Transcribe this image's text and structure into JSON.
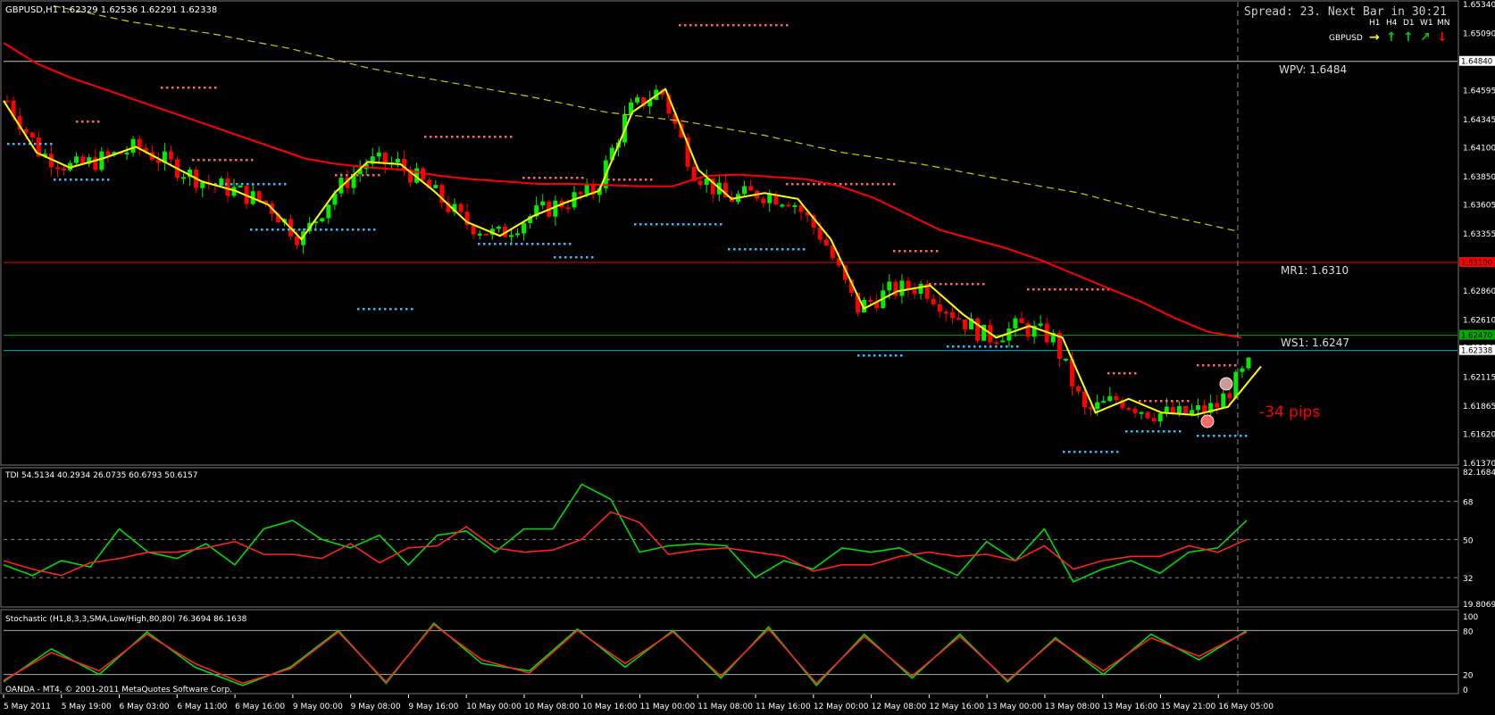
{
  "window": {
    "symbol_info": "GBPUSD,H1  1.62329 1.62536 1.62291 1.62338",
    "spread_text": "Spread: 23. Next Bar in 30:21",
    "copyright": "OANDA - MT4, © 2001-2011 MetaQuotes Software Corp."
  },
  "trend_panel": {
    "symbol": "GBPUSD",
    "timeframes": [
      "H1",
      "H4",
      "D1",
      "W1",
      "MN"
    ],
    "arrows": [
      {
        "dir": "right",
        "color": "#ffff00"
      },
      {
        "dir": "up",
        "color": "#00cc00"
      },
      {
        "dir": "up",
        "color": "#00cc00"
      },
      {
        "dir": "up-right",
        "color": "#00cc00"
      },
      {
        "dir": "down",
        "color": "#ff0000"
      }
    ]
  },
  "pivots": {
    "wpv": {
      "label": "WPV: 1.6484",
      "value": 1.6484,
      "color": "#c0c0c0"
    },
    "mr1": {
      "label": "MR1: 1.6310",
      "value": 1.631,
      "color": "#ff0000"
    },
    "ws1": {
      "label": "WS1: 1.6247",
      "value": 1.6247,
      "color": "#00aa00"
    },
    "bid": {
      "value": 1.62338,
      "color": "#00aacc"
    }
  },
  "annotation": {
    "text": "-34 pips",
    "color": "#ff0000"
  },
  "price_axis": {
    "ticks": [
      "1.65340",
      "1.65090",
      "1.64840",
      "1.64595",
      "1.64345",
      "1.64100",
      "1.63850",
      "1.63605",
      "1.63355",
      "1.63100",
      "1.62860",
      "1.62610",
      "1.62370",
      "1.62338",
      "1.62115",
      "1.61865",
      "1.61620",
      "1.61370"
    ],
    "highlighted": [
      {
        "label": "1.64840",
        "color": "#ffffff",
        "text_color": "#000000"
      },
      {
        "label": "1.63100",
        "color": "#ff0000",
        "text_color": "#000000"
      },
      {
        "label": "1.62470",
        "color": "#00aa00",
        "text_color": "#000000"
      },
      {
        "label": "1.62338",
        "color": "#ffffff",
        "text_color": "#000000"
      }
    ]
  },
  "time_axis": [
    "5 May 2011",
    "5 May 19:00",
    "6 May 03:00",
    "6 May 11:00",
    "6 May 16:00",
    "9 May 00:00",
    "9 May 08:00",
    "9 May 16:00",
    "10 May 00:00",
    "10 May 08:00",
    "10 May 16:00",
    "11 May 00:00",
    "11 May 08:00",
    "11 May 16:00",
    "12 May 00:00",
    "12 May 08:00",
    "12 May 16:00",
    "13 May 00:00",
    "13 May 08:00",
    "13 May 16:00",
    "15 May 21:00",
    "16 May 05:00"
  ],
  "tdi": {
    "label": "TDI 54.5134 40.2934 26.0735 60.6793 50.6157",
    "levels": [
      "82.1684",
      "68",
      "50",
      "32",
      "19.8069"
    ]
  },
  "stochastic": {
    "label": "Stochastic (H1,8,3,3,SMA,Low/High,80,80) 76.3694 86.1638",
    "levels": [
      "100",
      "80",
      "20",
      "0"
    ]
  },
  "chart_data": [
    {
      "type": "line",
      "title": "GBPUSD,H1",
      "ylim": [
        1.6137,
        1.6534
      ],
      "series": [
        {
          "name": "",
          "color": "#ff0000",
          "values": [
            1.65,
            1.6482,
            1.647,
            1.646,
            1.645,
            1.644,
            1.643,
            1.642,
            1.641,
            1.64,
            1.6395,
            1.6392,
            1.639,
            1.6385,
            1.6382,
            1.638,
            1.6378,
            1.6378,
            1.6377,
            1.6376,
            1.6376,
            1.6385,
            1.6386,
            1.6384,
            1.6382,
            1.6376,
            1.6366,
            1.6352,
            1.6338,
            1.633,
            1.6322,
            1.6312,
            1.63,
            1.6288,
            1.6276,
            1.6262,
            1.625,
            1.6245
          ]
        },
        {
          "name": "",
          "color": "#ffff00",
          "values": [
            1.645,
            1.6405,
            1.6392,
            1.64,
            1.641,
            1.6395,
            1.638,
            1.6372,
            1.636,
            1.633,
            1.637,
            1.6397,
            1.6395,
            1.6372,
            1.6345,
            1.6333,
            1.635,
            1.6362,
            1.6372,
            1.644,
            1.646,
            1.639,
            1.6365,
            1.637,
            1.6365,
            1.633,
            1.627,
            1.6285,
            1.629,
            1.6265,
            1.6245,
            1.6255,
            1.6245,
            1.618,
            1.6192,
            1.618,
            1.6178,
            1.6185,
            1.622
          ]
        },
        {
          "name": "",
          "color": "#cccc00",
          "values": [
            1.6532,
            1.6518,
            1.6508,
            1.6495,
            1.6478,
            1.6466,
            1.6454,
            1.644,
            1.6432,
            1.642,
            1.6405,
            1.6395,
            1.6382,
            1.637,
            1.6352,
            1.6337
          ]
        }
      ]
    },
    {
      "type": "line",
      "title": "TDI",
      "ylim": [
        19.8069,
        82.1684
      ],
      "series": [
        {
          "name": "",
          "color": "#00dd00",
          "values": [
            38,
            33,
            40,
            37,
            55,
            44,
            41,
            48,
            38,
            55,
            59,
            50,
            46,
            52,
            38,
            52,
            54,
            44,
            55,
            55,
            76,
            69,
            44,
            47,
            48,
            47,
            32,
            40,
            36,
            46,
            44,
            46,
            39,
            33,
            49,
            40,
            55,
            30,
            36,
            40,
            34,
            44,
            46,
            59
          ]
        },
        {
          "name": "",
          "color": "#ff2222",
          "values": [
            40,
            36,
            33,
            39,
            41,
            44,
            44,
            46,
            49,
            43,
            43,
            41,
            48,
            39,
            46,
            47,
            56,
            46,
            44,
            45,
            50,
            63,
            58,
            43,
            45,
            46,
            44,
            42,
            35,
            38,
            38,
            42,
            44,
            42,
            43,
            40,
            47,
            36,
            40,
            42,
            42,
            47,
            44,
            50
          ]
        }
      ]
    },
    {
      "type": "line",
      "title": "Stochastic",
      "ylim": [
        0,
        100
      ],
      "series": [
        {
          "name": "",
          "color": "#00dd00",
          "values": [
            10,
            55,
            20,
            78,
            30,
            5,
            30,
            80,
            8,
            90,
            35,
            25,
            82,
            30,
            80,
            15,
            85,
            5,
            75,
            15,
            75,
            10,
            70,
            20,
            75,
            40,
            80
          ]
        },
        {
          "name": "",
          "color": "#ff2222",
          "values": [
            12,
            50,
            25,
            75,
            35,
            8,
            28,
            78,
            10,
            88,
            40,
            22,
            80,
            35,
            78,
            18,
            82,
            8,
            72,
            18,
            72,
            12,
            68,
            25,
            70,
            45,
            78
          ]
        }
      ]
    }
  ]
}
